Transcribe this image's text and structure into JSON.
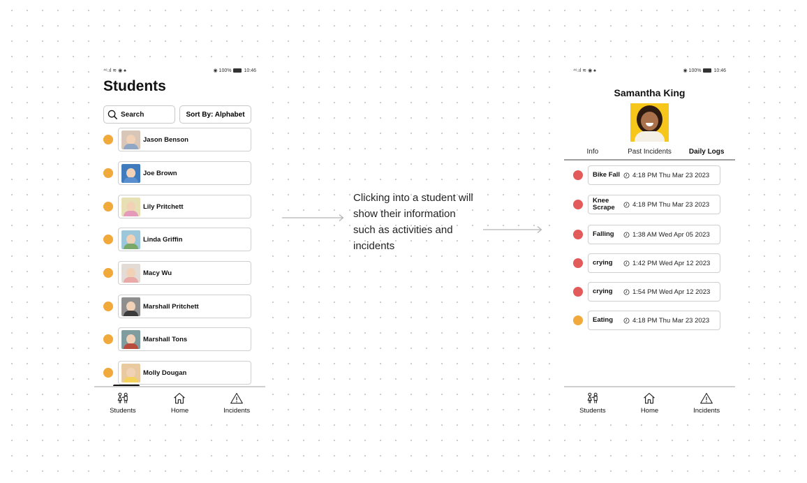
{
  "colors": {
    "status_orange": "#f0a93a",
    "status_red": "#e35a5a",
    "border": "#cfcfcf"
  },
  "status_bar": {
    "signal_icons": "⁴⁶.ıl ≋ ◉ ♠",
    "battery_text": "◉ 100%",
    "time": "10:46"
  },
  "left_screen": {
    "title": "Students",
    "search": {
      "placeholder": "Search",
      "icon": "search-icon"
    },
    "sort_button": "Sort By: Alphabet",
    "students": [
      {
        "name": "Jason Benson",
        "status_color": "#f0a93a",
        "avatar_bg": "#d8c7b8",
        "avatar_body": "#8fa7c4"
      },
      {
        "name": "Joe Brown",
        "status_color": "#f0a93a",
        "avatar_bg": "#3f7bbd",
        "avatar_body": "#5a8fcf"
      },
      {
        "name": "Lily Pritchett",
        "status_color": "#f0a93a",
        "avatar_bg": "#e7e0b4",
        "avatar_body": "#e49ab8"
      },
      {
        "name": "Linda Griffin",
        "status_color": "#f0a93a",
        "avatar_bg": "#9cc6d9",
        "avatar_body": "#79a86a"
      },
      {
        "name": "Macy Wu",
        "status_color": "#f0a93a",
        "avatar_bg": "#e3dcd6",
        "avatar_body": "#e9a9a6"
      },
      {
        "name": "Marshall Pritchett",
        "status_color": "#f0a93a",
        "avatar_bg": "#8e8e8e",
        "avatar_body": "#3b3b3b"
      },
      {
        "name": "Marshall Tons",
        "status_color": "#f0a93a",
        "avatar_bg": "#7f9c9e",
        "avatar_body": "#b84d3e"
      },
      {
        "name": "Molly Dougan",
        "status_color": "#f0a93a",
        "avatar_bg": "#e9c9a0",
        "avatar_body": "#f3d35b"
      }
    ]
  },
  "caption": "Clicking into a student will show their information such as activities and incidents",
  "right_screen": {
    "student_name": "Samantha King",
    "tabs": [
      {
        "label": "Info",
        "active": false
      },
      {
        "label": "Past Incidents",
        "active": false
      },
      {
        "label": "Daily Logs",
        "active": true
      }
    ],
    "logs": [
      {
        "label": "Bike Fall",
        "time": "4:18 PM Thu Mar 23 2023",
        "status_color": "#e35a5a"
      },
      {
        "label": "Knee Scrape",
        "time": "4:18 PM Thu Mar 23 2023",
        "status_color": "#e35a5a"
      },
      {
        "label": "Falling",
        "time": "1:38 AM Wed Apr 05 2023",
        "status_color": "#e35a5a"
      },
      {
        "label": "crying",
        "time": "1:42 PM Wed Apr 12 2023",
        "status_color": "#e35a5a"
      },
      {
        "label": "crying",
        "time": "1:54 PM Wed Apr 12 2023",
        "status_color": "#e35a5a"
      },
      {
        "label": "Eating",
        "time": "4:18 PM Thu Mar 23 2023",
        "status_color": "#f0a93a"
      }
    ]
  },
  "bottom_nav": [
    {
      "label": "Students",
      "icon": "children-icon"
    },
    {
      "label": "Home",
      "icon": "home-icon"
    },
    {
      "label": "Incidents",
      "icon": "warning-icon"
    }
  ]
}
